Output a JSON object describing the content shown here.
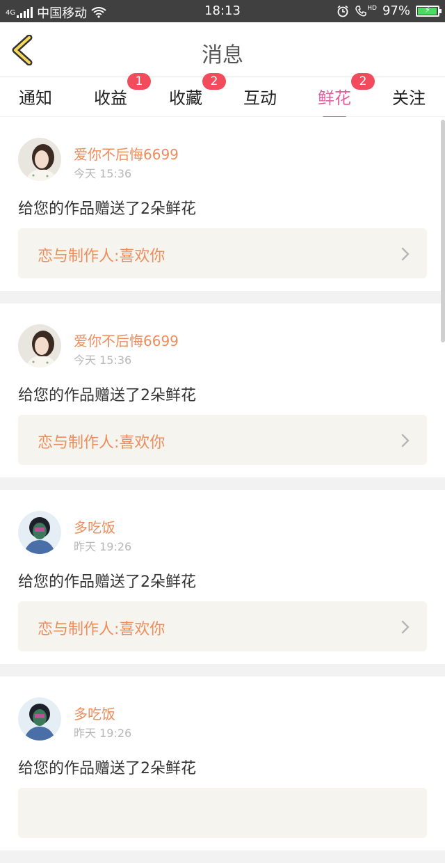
{
  "status_bar": {
    "network": "4G",
    "carrier": "中国移动",
    "time": "18:13",
    "hd": "HD",
    "battery": "97%"
  },
  "header": {
    "title": "消息"
  },
  "tabs": [
    {
      "label": "通知",
      "badge": ""
    },
    {
      "label": "收益",
      "badge": "1"
    },
    {
      "label": "收藏",
      "badge": "2"
    },
    {
      "label": "互动",
      "badge": ""
    },
    {
      "label": "鲜花",
      "badge": "2"
    },
    {
      "label": "关注",
      "badge": ""
    }
  ],
  "active_tab": "鲜花",
  "colors": {
    "accent": "#e0609d",
    "username": "#ef8c5b",
    "badge": "#f14b5c"
  },
  "messages": [
    {
      "username": "爱你不后悔6699",
      "time": "今天 15:36",
      "text": "给您的作品赠送了2朵鲜花",
      "work": "恋与制作人:喜欢你",
      "avatar": "girl-avatar"
    },
    {
      "username": "爱你不后悔6699",
      "time": "今天 15:36",
      "text": "给您的作品赠送了2朵鲜花",
      "work": "恋与制作人:喜欢你",
      "avatar": "girl-avatar"
    },
    {
      "username": "多吃饭",
      "time": "昨天 19:26",
      "text": "给您的作品赠送了2朵鲜花",
      "work": "恋与制作人:喜欢你",
      "avatar": "boy-avatar"
    },
    {
      "username": "多吃饭",
      "time": "昨天 19:26",
      "text": "给您的作品赠送了2朵鲜花",
      "work": "",
      "avatar": "boy-avatar"
    }
  ]
}
